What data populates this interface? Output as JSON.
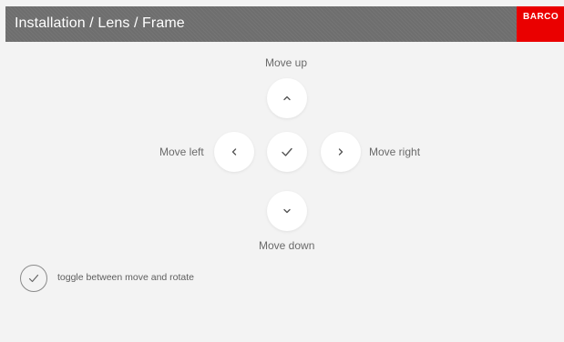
{
  "header": {
    "title": "Installation / Lens / Frame",
    "brand": "BARCO",
    "brand_color": "#ea0000",
    "bar_color": "#6e6e6e"
  },
  "controls": {
    "move_up_label": "Move up",
    "move_down_label": "Move down",
    "move_left_label": "Move left",
    "move_right_label": "Move right",
    "up_icon": "chevron-up-icon",
    "down_icon": "chevron-down-icon",
    "left_icon": "chevron-left-icon",
    "right_icon": "chevron-right-icon",
    "center_icon": "checkmark-icon"
  },
  "toggle": {
    "label": "toggle between move and rotate",
    "icon": "checkmark-icon"
  }
}
